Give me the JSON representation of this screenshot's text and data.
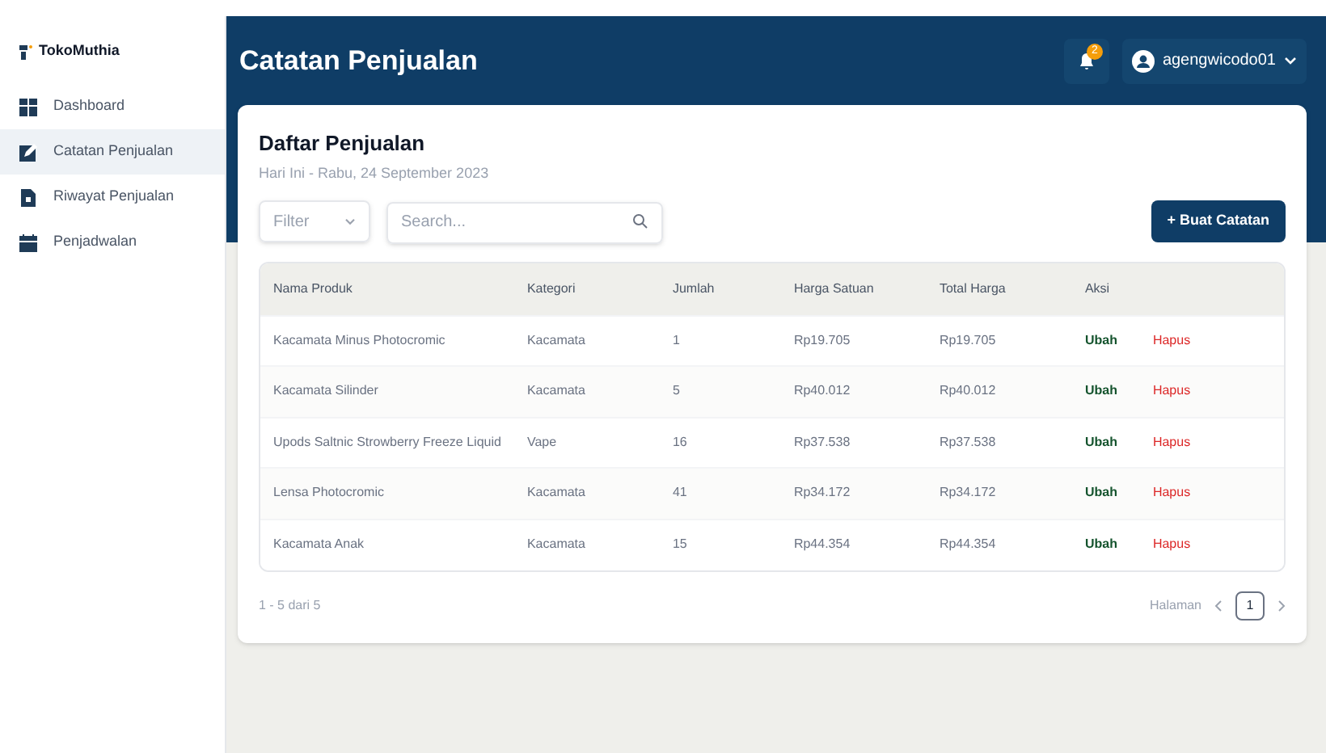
{
  "sidebar": {
    "brand": "TokoMuthia",
    "items": [
      {
        "label": "Dashboard",
        "selected": false
      },
      {
        "label": "Catatan Penjualan",
        "selected": true
      },
      {
        "label": "Riwayat Penjualan",
        "selected": false
      },
      {
        "label": "Penjadwalan",
        "selected": false
      }
    ]
  },
  "header": {
    "title": "Catatan Penjualan",
    "notification_count": "2",
    "user": "agengwicodo01"
  },
  "card": {
    "title": "Daftar Penjualan",
    "subtitle": "Hari Ini - Rabu, 24 September 2023",
    "filter": {
      "value": "Filter"
    },
    "search": {
      "placeholder": "Search..."
    },
    "create_button": "+ Buat Catatan"
  },
  "table": {
    "columns": [
      "Nama Produk",
      "Kategori",
      "Jumlah",
      "Harga Satuan",
      "Total Harga",
      "Aksi"
    ],
    "rows": [
      {
        "cells": [
          "Kacamata Minus Photocromic",
          "Kacamata",
          "1",
          "Rp19.705",
          "Rp19.705"
        ],
        "actions": [
          "Ubah",
          "Hapus"
        ]
      },
      {
        "cells": [
          "Kacamata Silinder",
          "Kacamata",
          "5",
          "Rp40.012",
          "Rp40.012"
        ],
        "actions": [
          "Ubah",
          "Hapus"
        ]
      },
      {
        "cells": [
          "Upods Saltnic Strowberry Freeze Liquid",
          "Vape",
          "16",
          "Rp37.538",
          "Rp37.538"
        ],
        "actions": [
          "Ubah",
          "Hapus"
        ]
      },
      {
        "cells": [
          "Lensa Photocromic",
          "Kacamata",
          "41",
          "Rp34.172",
          "Rp34.172"
        ],
        "actions": [
          "Ubah",
          "Hapus"
        ]
      },
      {
        "cells": [
          "Kacamata Anak",
          "Kacamata",
          "15",
          "Rp44.354",
          "Rp44.354"
        ],
        "actions": [
          "Ubah",
          "Hapus"
        ]
      }
    ]
  },
  "footer": {
    "range": "1 - 5 dari 5",
    "page_label": "Halaman",
    "pages": [
      {
        "label": "1",
        "selected": true
      }
    ]
  }
}
